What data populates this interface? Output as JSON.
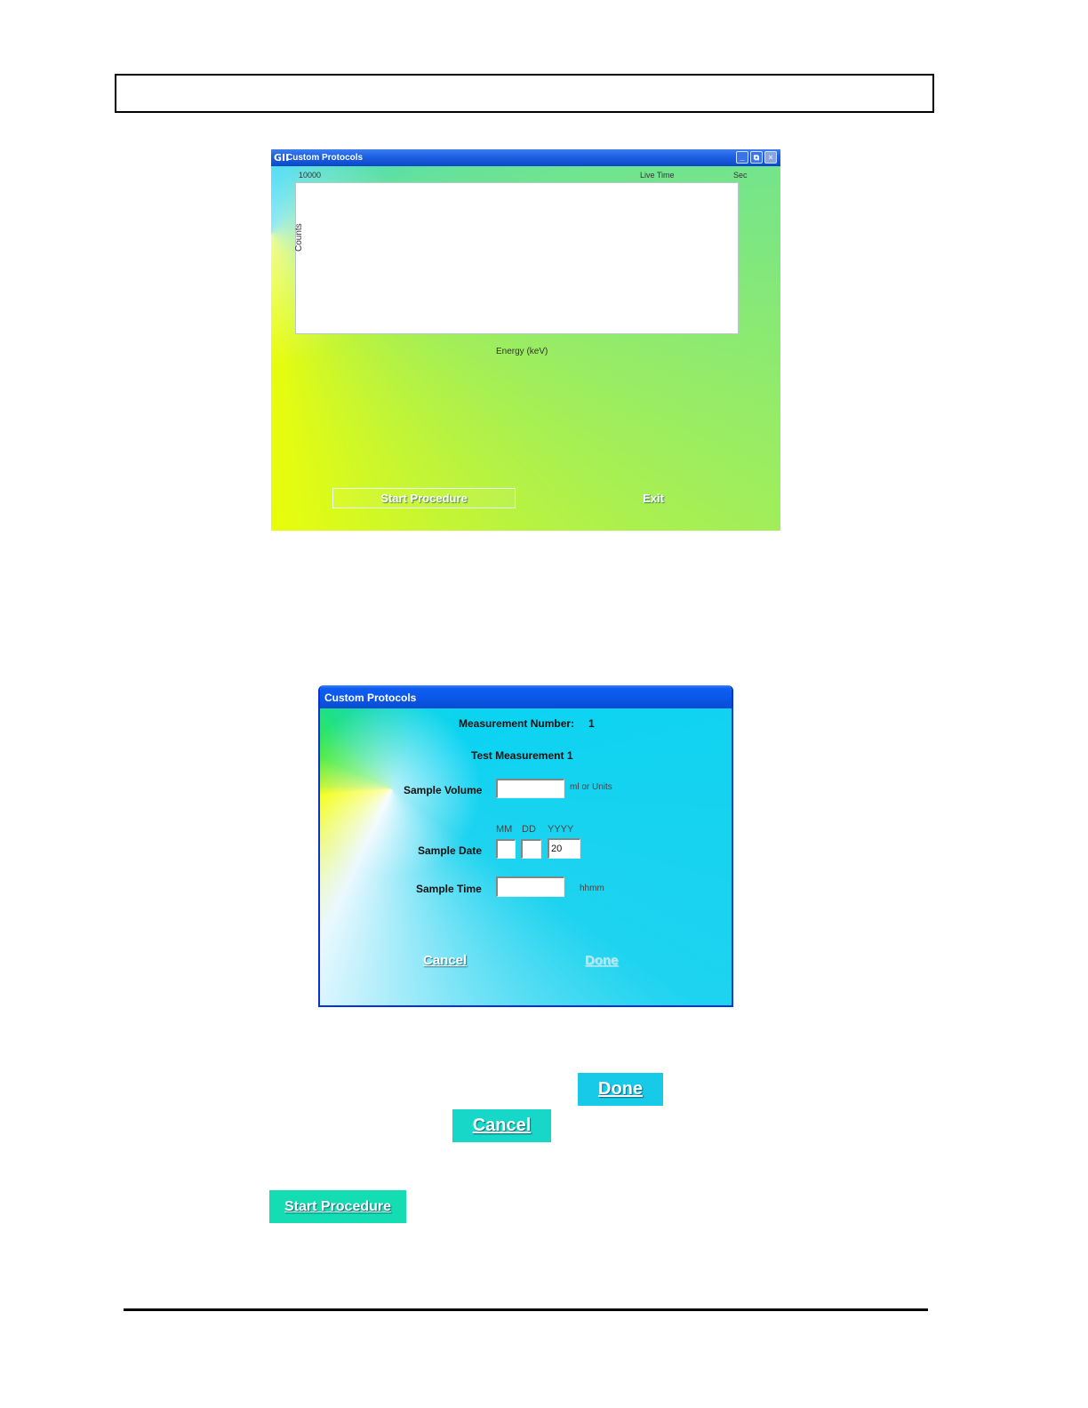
{
  "window1": {
    "title": "Custom Protocols",
    "logo": "GII",
    "controls": {
      "minimize": "_",
      "restore": "⧉",
      "close": "×"
    },
    "plot": {
      "y_max_label": "10000",
      "live_time_label": "Live Time",
      "sec_label": "Sec",
      "y_axis_label": "Counts",
      "x_axis_label": "Energy (keV)"
    },
    "start_label": "Start Procedure",
    "exit_label": "Exit"
  },
  "window2": {
    "title": "Custom Protocols",
    "measurement_label": "Measurement Number:",
    "measurement_number": "1",
    "measurement_name": "Test Measurement 1",
    "sample_volume_label": "Sample Volume",
    "sample_volume_value": "",
    "volume_unit": "ml or Units",
    "date_headers": {
      "mm": "MM",
      "dd": "DD",
      "yyyy": "YYYY"
    },
    "sample_date_label": "Sample Date",
    "date_mm_value": "",
    "date_dd_value": "",
    "date_yyyy_value": "20",
    "sample_time_label": "Sample Time",
    "sample_time_value": "",
    "time_unit": "hhmm",
    "cancel_label": "Cancel",
    "done_label": "Done"
  },
  "standalone_buttons": {
    "done_label": "Done",
    "cancel_label": "Cancel",
    "start_label": "Start Procedure"
  }
}
